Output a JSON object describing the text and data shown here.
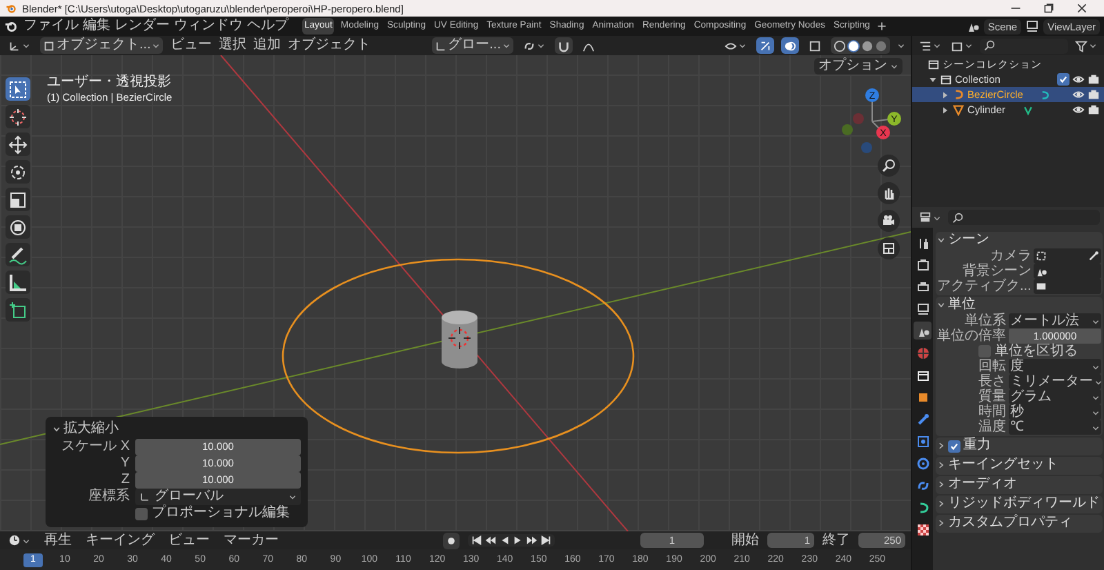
{
  "window": {
    "title": "Blender* [C:\\Users\\utoga\\Desktop\\utogaruzu\\blender\\peroperoi\\HP-peropero.blend]"
  },
  "menu": [
    "ファイル",
    "編集",
    "レンダー",
    "ウィンドウ",
    "ヘルプ"
  ],
  "workspaces": [
    {
      "label": "Layout",
      "selected": true
    },
    {
      "label": "Modeling",
      "selected": false
    },
    {
      "label": "Sculpting",
      "selected": false
    },
    {
      "label": "UV Editing",
      "selected": false
    },
    {
      "label": "Texture Paint",
      "selected": false
    },
    {
      "label": "Shading",
      "selected": false
    },
    {
      "label": "Animation",
      "selected": false
    },
    {
      "label": "Rendering",
      "selected": false
    },
    {
      "label": "Compositing",
      "selected": false
    },
    {
      "label": "Geometry Nodes",
      "selected": false
    },
    {
      "label": "Scripting",
      "selected": false
    }
  ],
  "scene": "Scene",
  "view_layer": "ViewLayer",
  "viewport": {
    "mode": "オブジェクト...",
    "menus": [
      "ビュー",
      "選択",
      "追加",
      "オブジェクト"
    ],
    "orientation": "グロー...",
    "options": "オプション",
    "view_name": "ユーザー・透視投影",
    "context": "(1) Collection | BezierCircle",
    "tools": [
      {
        "kind": "select",
        "selected": true
      },
      {
        "kind": "cursor",
        "selected": false
      },
      {
        "kind": "move",
        "selected": false
      },
      {
        "kind": "rotate",
        "selected": false
      },
      {
        "kind": "scale",
        "selected": false
      },
      {
        "kind": "transform",
        "selected": false
      },
      {
        "kind": "annotate",
        "selected": false
      },
      {
        "kind": "measure",
        "selected": false
      },
      {
        "kind": "add",
        "selected": false
      }
    ],
    "gizmo": {
      "x": "X",
      "y": "Y",
      "z": "Z"
    },
    "operator_panel": {
      "title": "拡大縮小",
      "expanded": true,
      "fields": [
        {
          "label": "スケール X",
          "value": "10.000"
        },
        {
          "label": "Y",
          "value": "10.000"
        },
        {
          "label": "Z",
          "value": "10.000"
        }
      ],
      "orientation_label": "座標系",
      "orientation": "グローバル",
      "proportional": {
        "label": "プロポーショナル編集",
        "checked": false
      }
    }
  },
  "outliner": {
    "items": [
      {
        "label": "シーンコレクション",
        "kind": "scene",
        "selected": false,
        "children": [
          {
            "label": "Collection",
            "kind": "collection",
            "selected": false,
            "expanded": true,
            "checked": true,
            "children": [
              {
                "label": "BezierCircle",
                "kind": "curve",
                "selected": true,
                "expanded": false
              },
              {
                "label": "Cylinder",
                "kind": "mesh",
                "selected": false,
                "expanded": false
              }
            ]
          }
        ]
      }
    ]
  },
  "properties": {
    "tabs": [
      {
        "kind": "tool",
        "selected": false
      },
      {
        "kind": "render",
        "selected": false
      },
      {
        "kind": "output",
        "selected": false
      },
      {
        "kind": "view_layer",
        "selected": false
      },
      {
        "kind": "scene",
        "selected": true
      },
      {
        "kind": "world",
        "selected": false
      },
      {
        "kind": "collection",
        "selected": false
      },
      {
        "kind": "object",
        "selected": false
      },
      {
        "kind": "modifier",
        "selected": false
      },
      {
        "kind": "particles",
        "selected": false
      },
      {
        "kind": "physics",
        "selected": false
      },
      {
        "kind": "constraints",
        "selected": false
      },
      {
        "kind": "data",
        "selected": false
      },
      {
        "kind": "texture",
        "selected": false
      }
    ],
    "panels": [
      {
        "title": "シーン",
        "kind": "plain",
        "expanded": true,
        "rows": [
          {
            "label": "カメラ",
            "kind": "object"
          },
          {
            "label": "背景シーン",
            "kind": "scene"
          },
          {
            "label": "アクティブク...",
            "kind": "clip"
          }
        ]
      },
      {
        "title": "単位",
        "kind": "plain",
        "expanded": true,
        "rows": [
          {
            "label": "単位系",
            "kind": "dropdown",
            "value": "メートル法"
          },
          {
            "label": "単位の倍率",
            "kind": "number",
            "value": "1.000000"
          },
          {
            "label": "単位を区切る",
            "kind": "checkbox",
            "checked": false
          },
          {
            "label": "回転",
            "kind": "dropdown",
            "value": "度"
          },
          {
            "label": "長さ",
            "kind": "dropdown",
            "value": "ミリメーター"
          },
          {
            "label": "質量",
            "kind": "dropdown",
            "value": "グラム"
          },
          {
            "label": "時間",
            "kind": "dropdown",
            "value": "秒"
          },
          {
            "label": "温度",
            "kind": "dropdown",
            "value": "℃"
          }
        ]
      },
      {
        "title": "重力",
        "kind": "toggle",
        "checked": true,
        "expanded": false
      },
      {
        "title": "キーイングセット",
        "kind": "plain",
        "expanded": false
      },
      {
        "title": "オーディオ",
        "kind": "plain",
        "expanded": false
      },
      {
        "title": "リジッドボディワールド",
        "kind": "plain",
        "expanded": false
      },
      {
        "title": "カスタムプロパティ",
        "kind": "plain",
        "expanded": false
      }
    ]
  },
  "timeline": {
    "menus": [
      "再生",
      "キーイング",
      "ビュー",
      "マーカー"
    ],
    "current": "1",
    "start_label": "開始",
    "start": "1",
    "end_label": "終了",
    "end": "250",
    "playhead": "1",
    "ruler": [
      "10",
      "20",
      "30",
      "40",
      "50",
      "60",
      "70",
      "80",
      "90",
      "100",
      "110",
      "120",
      "130",
      "140",
      "150",
      "160",
      "170",
      "180",
      "190",
      "200",
      "210",
      "220",
      "230",
      "240",
      "250"
    ]
  }
}
